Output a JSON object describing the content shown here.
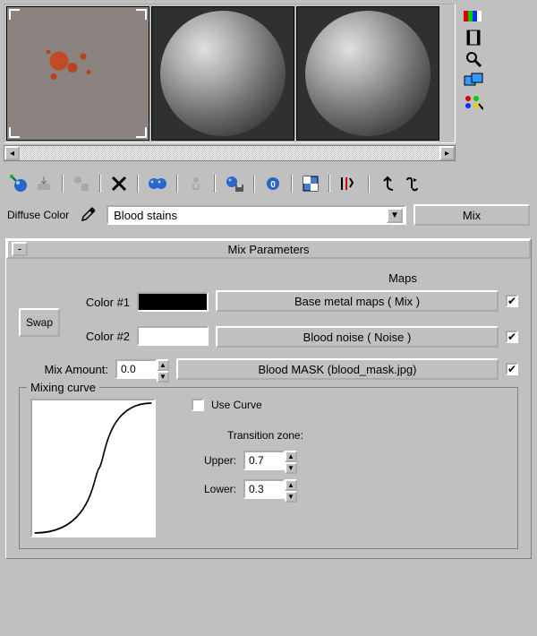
{
  "side_icons": {
    "colorbar": "colorbar",
    "film": "film",
    "magnify": "magnify",
    "screens": "screens",
    "quad": "colordots"
  },
  "slot_label": "Diffuse Color",
  "material_name": "Blood stains",
  "type_button": "Mix",
  "rollout_title": "Mix Parameters",
  "maps_header": "Maps",
  "swap_label": "Swap",
  "color1_label": "Color #1",
  "color2_label": "Color #2",
  "map1_label": "Base metal maps  ( Mix )",
  "map2_label": "Blood noise  ( Noise )",
  "mix_amount_label": "Mix Amount:",
  "mix_amount_value": "0.0",
  "mix_map_label": "Blood MASK (blood_mask.jpg)",
  "mixing_curve_label": "Mixing curve",
  "use_curve_label": "Use Curve",
  "transition_label": "Transition zone:",
  "upper_label": "Upper:",
  "upper_value": "0.7",
  "lower_label": "Lower:",
  "lower_value": "0.3",
  "checks": {
    "m1": "✔",
    "m2": "✔",
    "mix": "✔"
  }
}
